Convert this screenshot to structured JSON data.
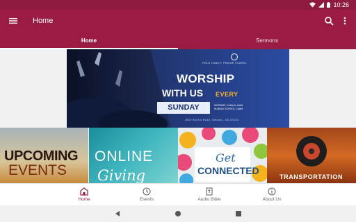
{
  "status_bar": {
    "time": "10:26"
  },
  "app_bar": {
    "title": "Home"
  },
  "tabs": [
    {
      "label": "Home",
      "active": true
    },
    {
      "label": "Sermons",
      "active": false
    }
  ],
  "hero": {
    "church_name": "HOLD FAMILY PRAISE CHAPEL",
    "line1": "WORSHIP",
    "line2": "WITH US",
    "line2b": "EVERY",
    "day": "SUNDAY",
    "times_line1": "WORSHIP: 10AM & 11AM",
    "times_line2": "SUNDAY SCHOOL: 10AM",
    "address": "2820 Builtin Road, Decatur, GA 30034"
  },
  "tiles": [
    {
      "line1": "UPCOMING",
      "line2": "EVENTS"
    },
    {
      "line1": "ONLINE",
      "line2": "Giving"
    },
    {
      "line1": "Get",
      "line2": "CONNECTED"
    },
    {
      "line1": "TRANSPORTATION"
    }
  ],
  "bottom_nav": [
    {
      "label": "Home",
      "icon": "home-icon",
      "active": true
    },
    {
      "label": "Events",
      "icon": "clock-icon",
      "active": false
    },
    {
      "label": "Audio Bible",
      "icon": "bible-icon",
      "active": false
    },
    {
      "label": "About Us",
      "icon": "info-icon",
      "active": false
    }
  ],
  "colors": {
    "primary": "#9a1c42",
    "status": "#8e1a3e",
    "accent": "#f7b52b"
  }
}
